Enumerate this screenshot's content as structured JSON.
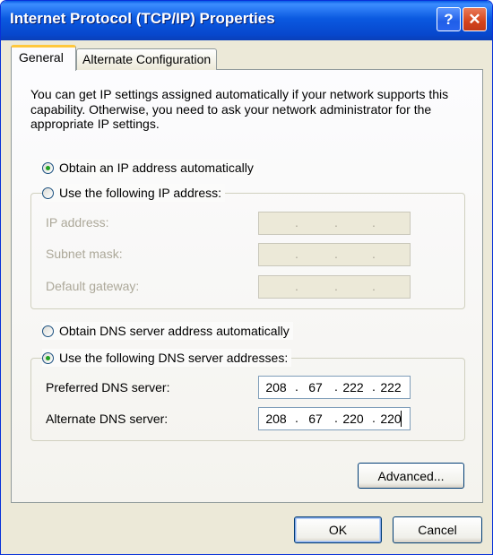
{
  "window": {
    "title": "Internet Protocol (TCP/IP) Properties",
    "help_glyph": "?",
    "close_glyph": "✕"
  },
  "tabs": [
    {
      "label": "General",
      "selected": true
    },
    {
      "label": "Alternate Configuration",
      "selected": false
    }
  ],
  "description": "You can get IP settings assigned automatically if your network supports this capability. Otherwise, you need to ask your network administrator for the appropriate IP settings.",
  "ip": {
    "auto_label": "Obtain an IP address automatically",
    "auto_selected": true,
    "manual_label": "Use the following IP address:",
    "manual_selected": false,
    "fields": [
      {
        "label": "IP address:",
        "value": [
          "",
          "",
          "",
          ""
        ],
        "enabled": false
      },
      {
        "label": "Subnet mask:",
        "value": [
          "",
          "",
          "",
          ""
        ],
        "enabled": false
      },
      {
        "label": "Default gateway:",
        "value": [
          "",
          "",
          "",
          ""
        ],
        "enabled": false
      }
    ]
  },
  "dns": {
    "auto_label": "Obtain DNS server address automatically",
    "auto_selected": false,
    "manual_label": "Use the following DNS server addresses:",
    "manual_selected": true,
    "preferred": {
      "label": "Preferred DNS server:",
      "octets": [
        "208",
        "67",
        "222",
        "222"
      ]
    },
    "alternate": {
      "label": "Alternate DNS server:",
      "octets": [
        "208",
        "67",
        "220",
        "220"
      ]
    }
  },
  "buttons": {
    "advanced": "Advanced...",
    "ok": "OK",
    "cancel": "Cancel"
  },
  "separator": "."
}
